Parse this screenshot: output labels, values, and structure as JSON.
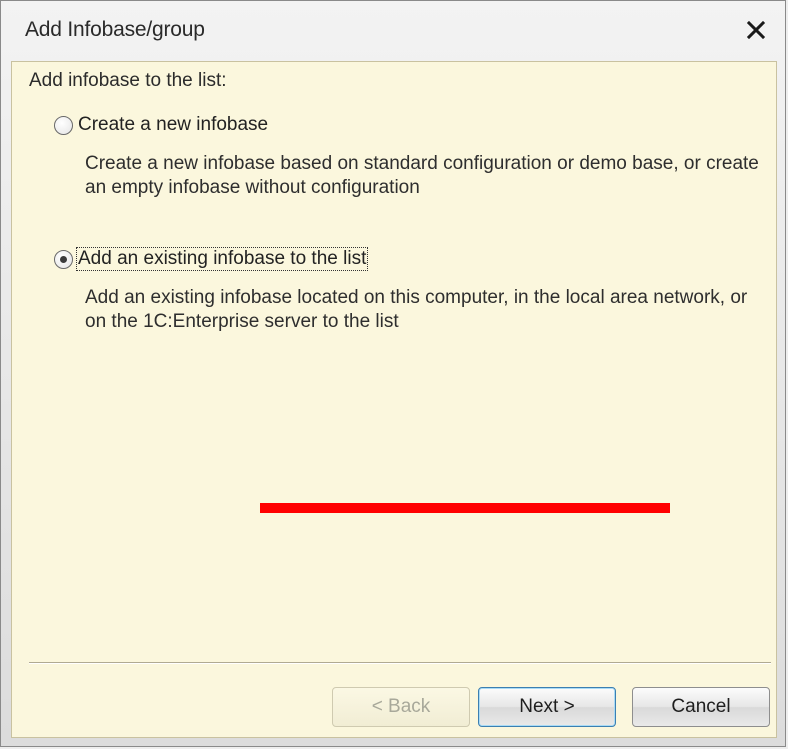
{
  "window": {
    "title": "Add Infobase/group",
    "close_icon": "close-icon"
  },
  "content": {
    "heading": "Add infobase to the list:",
    "options": [
      {
        "label": "Create a new infobase",
        "description": "Create a new infobase based on standard configuration or demo base, or create an empty infobase without configuration",
        "selected": false
      },
      {
        "label": "Add an existing infobase to the list",
        "description": "Add an existing infobase located on this computer, in the local area network, or on the 1C:Enterprise server to the list",
        "selected": true
      }
    ]
  },
  "buttons": {
    "back_label": "< Back",
    "next_label": "Next >",
    "cancel_label": "Cancel"
  },
  "colors": {
    "client_background": "#fbf7dd",
    "annotation_mark": "#ff0000"
  }
}
